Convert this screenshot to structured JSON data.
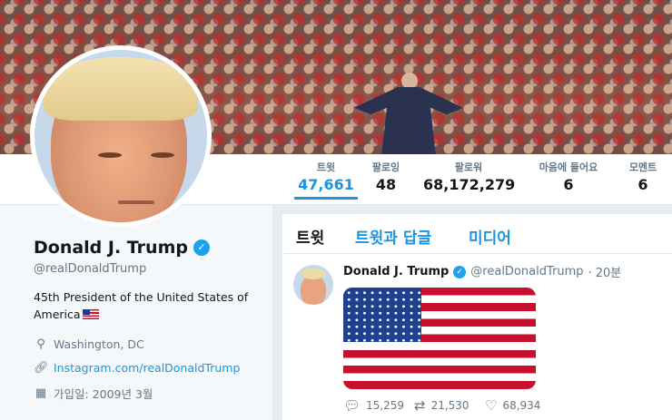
{
  "stats": [
    {
      "label": "트윗",
      "value": "47,661",
      "active": true
    },
    {
      "label": "팔로잉",
      "value": "48"
    },
    {
      "label": "팔로워",
      "value": "68,172,279"
    },
    {
      "label": "마음에 들어요",
      "value": "6"
    },
    {
      "label": "모멘트",
      "value": "6"
    }
  ],
  "profile": {
    "name": "Donald J. Trump",
    "handle": "@realDonaldTrump",
    "bio": "45th President of the United States of America",
    "location": "Washington, DC",
    "link": "Instagram.com/realDonaldTrump",
    "joined": "가입일: 2009년 3월",
    "icons": {
      "verified": "verified-badge-icon",
      "location": "location-pin-icon",
      "link": "link-icon",
      "calendar": "calendar-icon"
    }
  },
  "tabs": [
    "트윗",
    "트윗과 답글",
    "미디어"
  ],
  "tweet": {
    "name": "Donald J. Trump",
    "handle": "@realDonaldTrump",
    "time": "· 20분",
    "replies": "15,259",
    "retweets": "21,530",
    "likes": "68,934"
  },
  "colors": {
    "accent": "#1b95e0",
    "verified": "#1da1f2",
    "background": "#e6ecf0"
  }
}
